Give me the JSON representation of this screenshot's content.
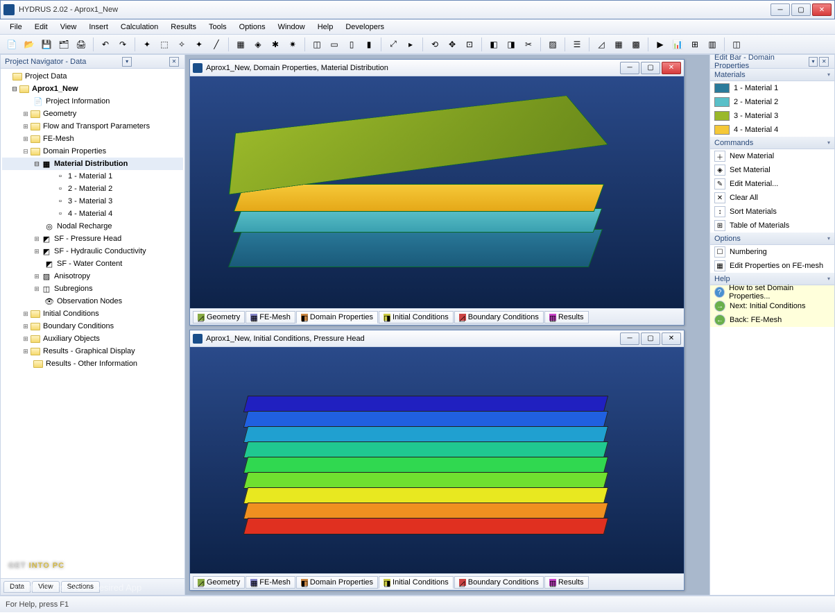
{
  "window": {
    "title": "HYDRUS 2.02 - Aprox1_New"
  },
  "menu": [
    "File",
    "Edit",
    "View",
    "Insert",
    "Calculation",
    "Results",
    "Tools",
    "Options",
    "Window",
    "Help",
    "Developers"
  ],
  "leftpanel": {
    "title": "Project Navigator - Data",
    "root": "Project Data",
    "project": "Aprox1_New",
    "items": {
      "project_info": "Project Information",
      "geometry": "Geometry",
      "flow": "Flow and Transport Parameters",
      "femesh": "FE-Mesh",
      "domain": "Domain Properties",
      "matdist": "Material Distribution",
      "mat1": "1 - Material 1",
      "mat2": "2 - Material 2",
      "mat3": "3 - Material 3",
      "mat4": "4 - Material 4",
      "nodal": "Nodal Recharge",
      "sf_pressure": "SF - Pressure Head",
      "sf_hydraulic": "SF - Hydraulic Conductivity",
      "sf_water": "SF - Water Content",
      "anisotropy": "Anisotropy",
      "subregions": "Subregions",
      "obs": "Observation Nodes",
      "initial": "Initial Conditions",
      "boundary": "Boundary Conditions",
      "aux": "Auxiliary Objects",
      "results_gd": "Results - Graphical Display",
      "results_oi": "Results - Other Information"
    },
    "bottomtabs": [
      "Data",
      "View",
      "Sections"
    ]
  },
  "subwindows": {
    "win1": {
      "title": "Aprox1_New, Domain Properties, Material Distribution"
    },
    "win2": {
      "title": "Aprox1_New, Initial Conditions, Pressure Head"
    }
  },
  "viewtabs": [
    "Geometry",
    "FE-Mesh",
    "Domain Properties",
    "Initial Conditions",
    "Boundary Conditions",
    "Results"
  ],
  "rightpanel": {
    "title": "Edit Bar - Domain Properties",
    "sections": {
      "materials": "Materials",
      "commands": "Commands",
      "options": "Options",
      "help": "Help"
    },
    "materials": [
      {
        "label": "1 - Material 1",
        "color": "#2a7a9a"
      },
      {
        "label": "2 - Material 2",
        "color": "#5ac0c8"
      },
      {
        "label": "3 - Material 3",
        "color": "#9ab82a"
      },
      {
        "label": "4 - Material 4",
        "color": "#f5c838"
      }
    ],
    "commands": [
      "New Material",
      "Set Material",
      "Edit Material...",
      "Clear All",
      "Sort Materials",
      "Table of Materials"
    ],
    "options": [
      "Numbering",
      "Edit Properties on FE-mesh"
    ],
    "help": [
      "How to set Domain Properties...",
      "Next: Initial Conditions",
      "Back: FE-Mesh"
    ]
  },
  "statusbar": "For Help, press F1",
  "watermark": {
    "t1a": "GET ",
    "t1b": "INTO PC",
    "t2": "Download Free Your Desired App"
  }
}
